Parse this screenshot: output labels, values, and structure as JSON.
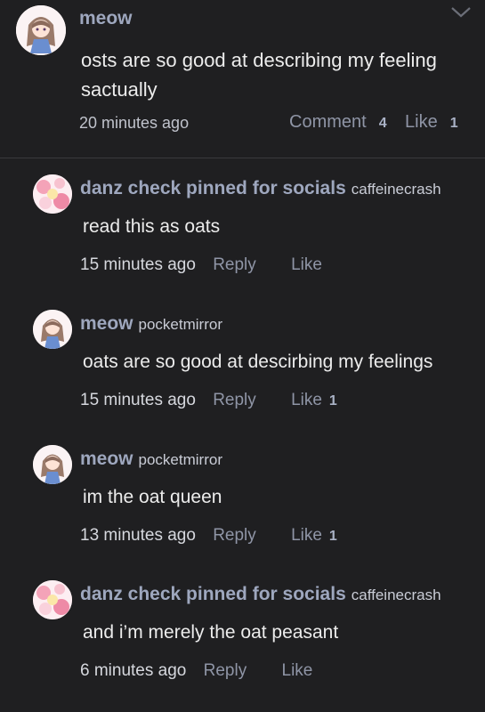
{
  "post": {
    "author": "meow",
    "text_line1": "osts are so good at describing my feeling",
    "text_line2": "sactually",
    "timestamp": "20 minutes ago",
    "comment_label": "Comment",
    "comment_count": "4",
    "like_label": "Like",
    "like_count": "1"
  },
  "replies": [
    {
      "author": "danz check pinned for socials",
      "handle": "caffeinecrash",
      "text": "read this as oats",
      "timestamp": "15 minutes ago",
      "reply_label": "Reply",
      "like_label": "Like",
      "like_count": ""
    },
    {
      "author": "meow",
      "handle": "pocketmirror",
      "text": "oats are so good at descirbing my feelings",
      "timestamp": "15 minutes ago",
      "reply_label": "Reply",
      "like_label": "Like",
      "like_count": "1"
    },
    {
      "author": "meow",
      "handle": "pocketmirror",
      "text": "im the oat queen",
      "timestamp": "13 minutes ago",
      "reply_label": "Reply",
      "like_label": "Like",
      "like_count": "1"
    },
    {
      "author": "danz check pinned for socials",
      "handle": "caffeinecrash",
      "text": "and i’m merely the oat peasant",
      "timestamp": "6 minutes ago",
      "reply_label": "Reply",
      "like_label": "Like",
      "like_count": ""
    }
  ]
}
